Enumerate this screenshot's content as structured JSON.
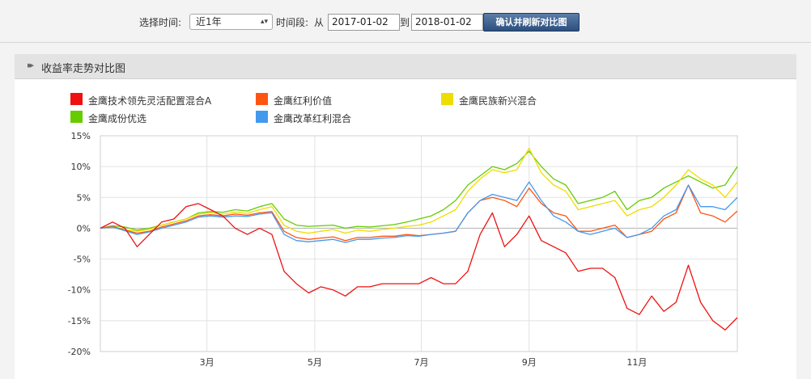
{
  "toolbar": {
    "select_time_label": "选择时间:",
    "period_value": "近1年",
    "period_label": "时间段:",
    "from_label": "从",
    "start_date": "2017-01-02",
    "to_label": "到",
    "end_date": "2018-01-02",
    "confirm_label": "确认并刷新对比图"
  },
  "panel": {
    "title": "收益率走势对比图"
  },
  "chart_data": {
    "type": "line",
    "ylim": [
      -20,
      15
    ],
    "y_ticks": [
      "15%",
      "10%",
      "5%",
      "0%",
      "-5%",
      "-10%",
      "-15%",
      "-20%"
    ],
    "y_tick_values": [
      15,
      10,
      5,
      0,
      -5,
      -10,
      -15,
      -20
    ],
    "x_range_weeks": [
      0,
      52
    ],
    "x_ticks": [
      {
        "label": "3月",
        "week": 8.7
      },
      {
        "label": "5月",
        "week": 17.5
      },
      {
        "label": "7月",
        "week": 26.2
      },
      {
        "label": "9月",
        "week": 35.0
      },
      {
        "label": "11月",
        "week": 43.8
      }
    ],
    "grid": true,
    "legend_position": "top-left",
    "series": [
      {
        "name": "金鹰技术领先灵活配置混合A",
        "color": "#ee1111",
        "values": [
          0,
          1.0,
          0,
          -3.0,
          -1.0,
          1.0,
          1.5,
          3.5,
          4.0,
          3.0,
          2.0,
          0,
          -1.0,
          0,
          -1.0,
          -7.0,
          -9.0,
          -10.5,
          -9.5,
          -10.0,
          -11.0,
          -9.5,
          -9.5,
          -9.0,
          -9.0,
          -9.0,
          -9.0,
          -8.0,
          -9.0,
          -9.0,
          -7.0,
          -1.0,
          2.5,
          -3.0,
          -1.0,
          2.0,
          -2.0,
          -3.0,
          -4.0,
          -7.0,
          -6.5,
          -6.5,
          -8.0,
          -13.0,
          -14.0,
          -11.0,
          -13.5,
          -12.0,
          -6.0,
          -12.0,
          -15.0,
          -16.5,
          -14.5
        ]
      },
      {
        "name": "金鹰红利价值",
        "color": "#ff5511",
        "values": [
          0,
          0.3,
          -0.3,
          -0.8,
          -0.5,
          0.2,
          0.7,
          1.2,
          2.0,
          2.2,
          2.0,
          2.3,
          2.1,
          2.5,
          2.7,
          -0.5,
          -1.5,
          -1.8,
          -1.6,
          -1.4,
          -2.0,
          -1.5,
          -1.5,
          -1.3,
          -1.3,
          -1.0,
          -1.2,
          -1.0,
          -0.8,
          -0.5,
          2.5,
          4.5,
          5.0,
          4.5,
          3.5,
          6.5,
          4.0,
          2.5,
          2.0,
          -0.5,
          -0.5,
          0,
          0.5,
          -1.5,
          -1.0,
          -0.5,
          1.5,
          2.5,
          7.0,
          2.5,
          2.0,
          1.0,
          2.8
        ]
      },
      {
        "name": "金鹰民族新兴混合",
        "color": "#eedd00",
        "values": [
          0,
          0.2,
          -0.2,
          -0.5,
          -0.2,
          0.5,
          1.0,
          1.5,
          2.3,
          2.5,
          2.3,
          2.6,
          2.4,
          3.0,
          3.5,
          0.5,
          -0.5,
          -0.8,
          -0.5,
          -0.2,
          -0.8,
          -0.3,
          -0.5,
          -0.2,
          0,
          0.3,
          0.5,
          1.0,
          2.0,
          3.0,
          6.0,
          8.0,
          9.5,
          9.0,
          9.5,
          13.0,
          9.0,
          7.0,
          6.0,
          3.0,
          3.5,
          4.0,
          4.5,
          2.0,
          3.0,
          3.5,
          5.0,
          7.0,
          9.5,
          8.0,
          7.0,
          5.0,
          7.5
        ]
      },
      {
        "name": "金鹰成份优选",
        "color": "#66cc00",
        "values": [
          0,
          0.4,
          0.2,
          -0.3,
          0,
          0.5,
          1.0,
          1.5,
          2.5,
          2.7,
          2.6,
          3.0,
          2.8,
          3.5,
          4.0,
          1.5,
          0.5,
          0.3,
          0.4,
          0.5,
          0,
          0.3,
          0.2,
          0.4,
          0.6,
          1.0,
          1.5,
          2.0,
          3.0,
          4.5,
          7.0,
          8.5,
          10.0,
          9.5,
          10.5,
          12.5,
          10.0,
          8.0,
          7.0,
          4.0,
          4.5,
          5.0,
          6.0,
          3.0,
          4.5,
          5.0,
          6.5,
          7.5,
          8.5,
          7.5,
          6.5,
          7.0,
          10.0
        ]
      },
      {
        "name": "金鹰改革红利混合",
        "color": "#4499ee",
        "values": [
          0,
          0.2,
          -0.4,
          -1.0,
          -0.6,
          0,
          0.5,
          1.0,
          1.8,
          2.0,
          1.8,
          2.0,
          1.9,
          2.3,
          2.5,
          -1.0,
          -2.0,
          -2.2,
          -2.0,
          -1.8,
          -2.3,
          -1.8,
          -1.8,
          -1.6,
          -1.5,
          -1.2,
          -1.3,
          -1.0,
          -0.8,
          -0.5,
          2.5,
          4.5,
          5.5,
          5.0,
          4.5,
          7.5,
          4.5,
          2.0,
          1.0,
          -0.5,
          -1.0,
          -0.5,
          0,
          -1.5,
          -1.0,
          0,
          2.0,
          3.0,
          7.0,
          3.5,
          3.5,
          3.0,
          5.0
        ]
      }
    ]
  }
}
